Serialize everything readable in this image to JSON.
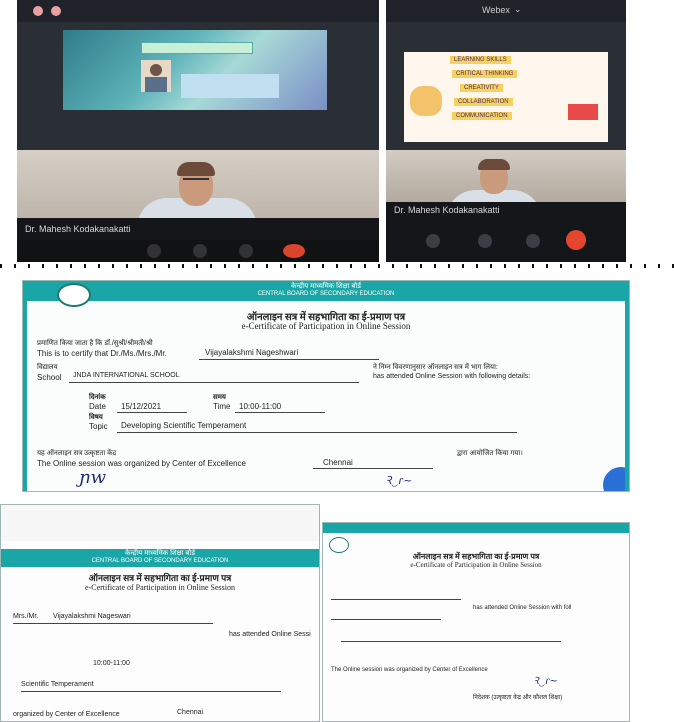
{
  "screenshot_left": {
    "slide_banner": "",
    "slide_lines": [
      "",
      "",
      ""
    ],
    "name_tag": "Dr. Mahesh Kodakanakatti"
  },
  "screenshot_right": {
    "topbar_title": "Webex",
    "slide_lines": [
      "LEARNING SKILLS",
      "CRITICAL THINKING",
      "CREATIVITY",
      "COLLABORATION",
      "COMMUNICATION"
    ],
    "name_tag": "Dr. Mahesh Kodakanakatti"
  },
  "cert_main": {
    "header_hindi": "केन्द्रीय माध्यमिक शिक्षा बोर्ड",
    "header_english": "CENTRAL BOARD OF SECONDARY EDUCATION",
    "title_hindi": "ऑनलाइन सत्र में सहभागिता का ई-प्रमाण पत्र",
    "title_english": "e-Certificate of Participation in Online Session",
    "certify_hindi": "प्रमाणित किया जाता है कि डॉ./सुश्री/श्रीमती/श्री",
    "certify_english": "This is to certify that Dr./Ms./Mrs./Mr.",
    "name": "Vijayalakshmi Nageshwari",
    "school_label_hindi": "विद्यालय",
    "school_label": "School",
    "school_name": "JNDA INTERNATIONAL SCHOOL",
    "attended_hindi": "ने निम्न विवरणानुसार ऑनलाइन सत्र में भाग लिया:",
    "attended_english": "has attended Online Session with following details:",
    "date_hindi": "दिनांक",
    "date_label": "Date",
    "date_value": "15/12/2021",
    "time_hindi": "समय",
    "time_label": "Time",
    "time_value": "10:00-11:00",
    "topic_hindi": "विषय",
    "topic_label": "Topic",
    "topic_value": "Developing Scientific Temperament",
    "organized_hindi": "यह ऑनलाइन सत्र उत्कृष्टता केंद्र",
    "organized_english": "The Online session was organized by Center of Excellence",
    "coe_city": "Chennai",
    "organized_suffix_hindi": "द्वारा आयोजित किया गया।"
  },
  "cert_left": {
    "header_hindi": "केन्द्रीय माध्यमिक शिक्षा बोर्ड",
    "header_english": "CENTRAL BOARD OF SECONDARY EDUCATION",
    "title_hindi": "ऑनलाइन सत्र में सहभागिता का ई-प्रमाण पत्र",
    "title_english": "e-Certificate of Participation in Online Session",
    "name_prefix": "Mrs./Mr.",
    "name": "Vijayalakshmi Nageswari",
    "attended_english": "has attended Online Sessi",
    "time_value": "10:00-11:00",
    "topic_value": "Scientific Temperament",
    "organized_english": "organized by Center of Excellence",
    "coe_city": "Chennai"
  },
  "cert_right": {
    "title_hindi": "ऑनलाइन सत्र में सहभागिता का ई-प्रमाण पत्र",
    "title_english": "e-Certificate of Participation in Online Session",
    "attended_english": "has attended Online Session with foll",
    "organized_english": "The Online session was organized by Center of Excellence",
    "footer_hindi": "निदेशक (उत्कृष्टता केंद्र और कौशल शिक्षा)"
  }
}
